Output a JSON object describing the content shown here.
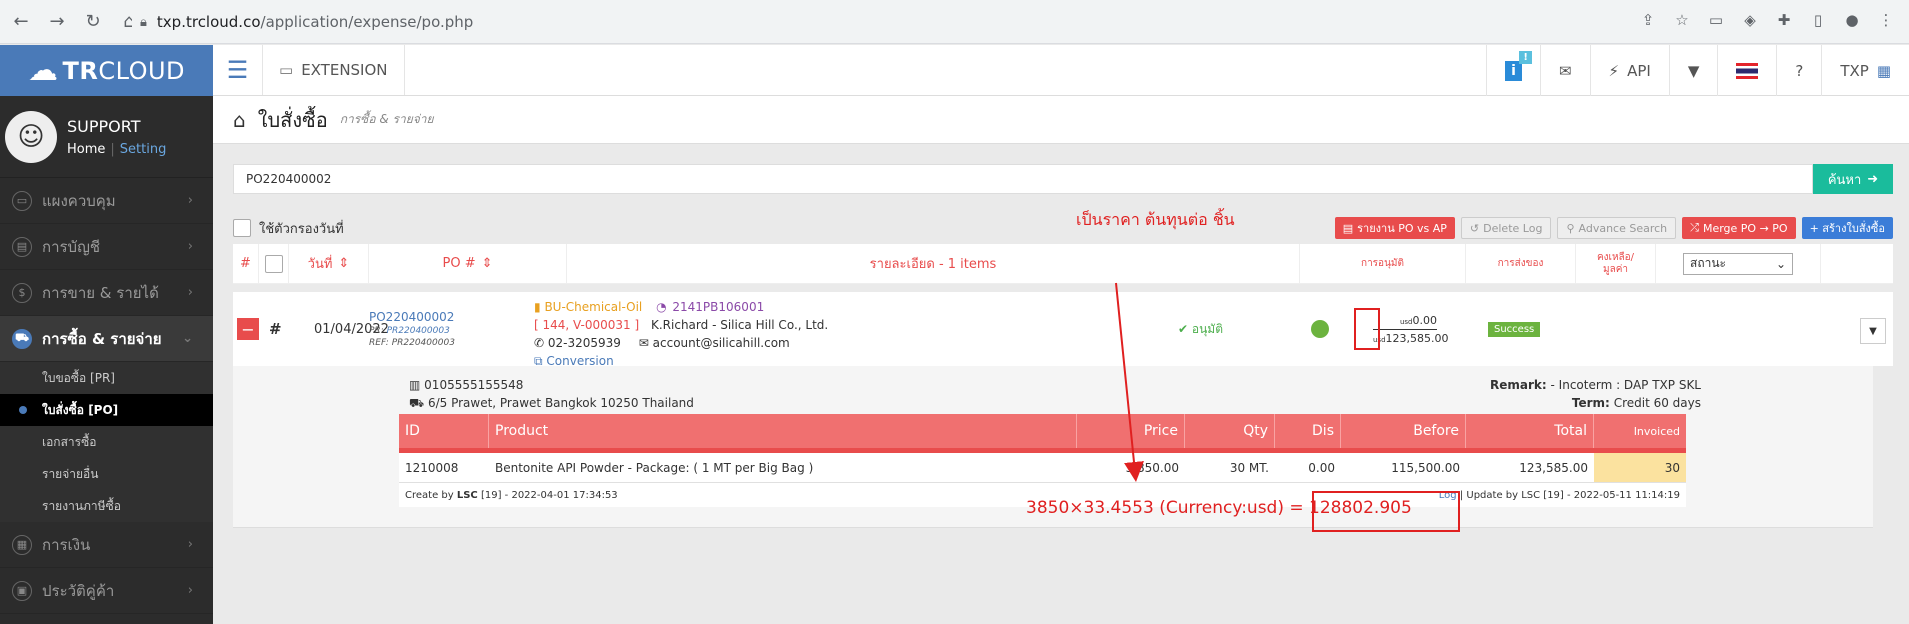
{
  "browser": {
    "url_host": "txp.trcloud.co",
    "url_path": "/application/expense/po.php"
  },
  "header": {
    "logo_bold": "TR",
    "logo_light": "CLOUD",
    "extension_label": "EXTENSION",
    "info_count": "!",
    "api_label": "API",
    "company_label": "TXP"
  },
  "sidebar": {
    "profile_name": "SUPPORT",
    "home_link": "Home",
    "setting_link": "Setting",
    "items": [
      {
        "label": "แผงควบคุม",
        "icon": "monitor-icon"
      },
      {
        "label": "การบัญชี",
        "icon": "book-icon"
      },
      {
        "label": "การขาย & รายได้",
        "icon": "dollar-icon"
      },
      {
        "label": "การซื้อ & รายจ่าย",
        "icon": "cart-icon"
      },
      {
        "label": "การเงิน",
        "icon": "calendar-icon"
      },
      {
        "label": "ประวัติคู่ค้า",
        "icon": "contacts-icon"
      }
    ],
    "sub_items": [
      {
        "label": "ใบขอซื้อ [PR]"
      },
      {
        "label": "ใบสั่งซื้อ [PO]"
      },
      {
        "label": "เอกสารซื้อ"
      },
      {
        "label": "รายจ่ายอื่น"
      },
      {
        "label": "รายงานภาษีซื้อ"
      }
    ]
  },
  "page": {
    "title": "ใบสั่งซื้อ",
    "subtitle": "การซื้อ & รายจ่าย"
  },
  "search": {
    "value": "PO220400002",
    "button_label": "ค้นหา"
  },
  "toolbar": {
    "date_filter_label": "ใช้ตัวกรองวันที่",
    "annotation": "เป็นราคา ต้นทุนต่อ ชิ้น",
    "report_btn": "รายงาน PO vs AP",
    "delete_log_btn": "Delete Log",
    "advance_search_btn": "Advance Search",
    "merge_btn": "Merge PO → PO",
    "create_btn": "+ สร้างใบสั่งซื้อ"
  },
  "list_head": {
    "hash": "#",
    "date": "วันที่",
    "po_no": "PO #",
    "detail": "รายละเอียด - 1 items",
    "approve": "การอนุมัติ",
    "delivery": "การส่งของ",
    "remain_line1": "คงเหลือ/",
    "remain_line2": "มูลค่า",
    "status_select": "สถานะ"
  },
  "po": {
    "hash": "#",
    "date": "01/04/2022",
    "number": "PO220400002",
    "pr_label": "PR:",
    "pr_value": "PR220400003",
    "ref_label": "REF:",
    "ref_value": "PR220400003",
    "bu": "BU-Chemical-Oil",
    "code": "2141PB106001",
    "vendor_code": "[ 144, V-000031 ]",
    "vendor_name": "K.Richard - Silica Hill Co., Ltd.",
    "phone": "02-3205939",
    "email": "account@silicahill.com",
    "conversion": "Conversion",
    "approve_status": "อนุมัติ",
    "remain_currency": "usd",
    "remain_value": "0.00",
    "total_value": "123,585.00",
    "status_badge": "Success"
  },
  "detail": {
    "tax_id": "0105555155548",
    "address": "6/5 Prawet, Prawet Bangkok 10250 Thailand",
    "remark_label": "Remark:",
    "remark_value": "- Incoterm : DAP TXP SKL",
    "term_label": "Term:",
    "term_value": "Credit 60 days"
  },
  "product_table": {
    "columns": [
      "ID",
      "Product",
      "Price",
      "Qty",
      "Dis",
      "Before",
      "Total",
      "Invoiced"
    ],
    "rows": [
      {
        "id": "1210008",
        "product": "Bentonite API Powder - Package: ( 1 MT per Big Bag )",
        "price": "3,850.00",
        "qty": "30 MT.",
        "dis": "0.00",
        "before": "115,500.00",
        "total": "123,585.00",
        "invoiced": "30"
      }
    ],
    "create_by": "Create by",
    "create_user": "LSC",
    "create_meta": "[19] - 2022-04-01 17:34:53",
    "log_link": "Log",
    "update_meta": "| Update by LSC [19] - 2022-05-11 11:14:19"
  },
  "annotation": {
    "calc": "3850×33.4553 (Currency:usd) = 128802.905"
  }
}
